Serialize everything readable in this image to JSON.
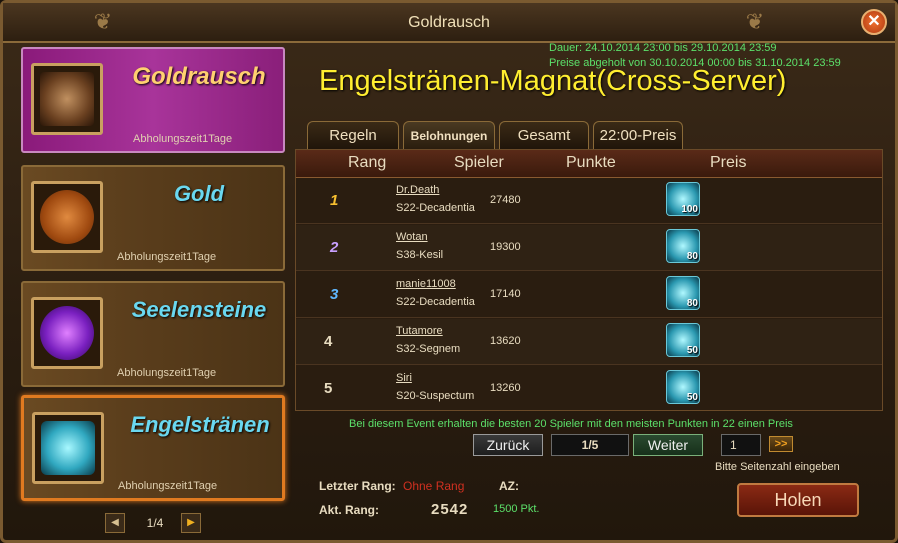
{
  "window": {
    "title": "Goldrausch"
  },
  "events": [
    {
      "name": "Goldrausch",
      "sub": "Abholungszeit1Tage"
    },
    {
      "name": "Gold",
      "sub": "Abholungszeit1Tage"
    },
    {
      "name": "Seelensteine",
      "sub": "Abholungszeit1Tage"
    },
    {
      "name": "Engelsträn​en",
      "sub": "Abholungszeit1Tage"
    }
  ],
  "event_pager": {
    "indicator": "1/4"
  },
  "dates": {
    "line1": "Dauer: 24.10.2014 23:00 bis 29.10.2014 23:59",
    "line2": "Preise abgeholt von 30.10.2014 00:00 bis 31.10.2014 23:59"
  },
  "headline": "Engelstränen-Magnat(Cross-Server)",
  "tabs": [
    "Regeln",
    "Belohnungen",
    "Gesamt",
    "22:00-Preis"
  ],
  "table": {
    "headers": [
      "Rang",
      "Spieler",
      "Punkte",
      "Preis"
    ],
    "rows": [
      {
        "rank": "1",
        "name": "Dr.Death",
        "server": "S22-Decadentia",
        "points": "27480",
        "prize": "100"
      },
      {
        "rank": "2",
        "name": "Wotan",
        "server": "S38-Kesil",
        "points": "19300",
        "prize": "80"
      },
      {
        "rank": "3",
        "name": "manie11008",
        "server": "S22-Decadentia",
        "points": "17140",
        "prize": "80"
      },
      {
        "rank": "4",
        "name": "Tutamore",
        "server": "S32-Segnem",
        "points": "13620",
        "prize": "50"
      },
      {
        "rank": "5",
        "name": "Siri",
        "server": "S20-Suspectum",
        "points": "13260",
        "prize": "50"
      }
    ]
  },
  "info": "Bei diesem Event erhalten die besten 20 Spieler mit den meisten Punkten in 22 einen Preis",
  "pagination": {
    "back": "Zurück",
    "indicator": "1/5",
    "next": "Weiter",
    "input_value": "1",
    "go": ">>",
    "hint": "Bitte Seitenzahl eingeben"
  },
  "stats": {
    "last_rank_label": "Letzter Rang:",
    "last_rank_value": "Ohne Rang",
    "az_label": "AZ:",
    "current_rank_label": "Akt. Rang:",
    "current_rank_value": "2542",
    "pkt_value": "1500 Pkt."
  },
  "holen": "Holen",
  "colors": {
    "accent_green": "#5ce06a",
    "headline_yellow": "#ffee30",
    "selected_orange": "#e07a20"
  }
}
